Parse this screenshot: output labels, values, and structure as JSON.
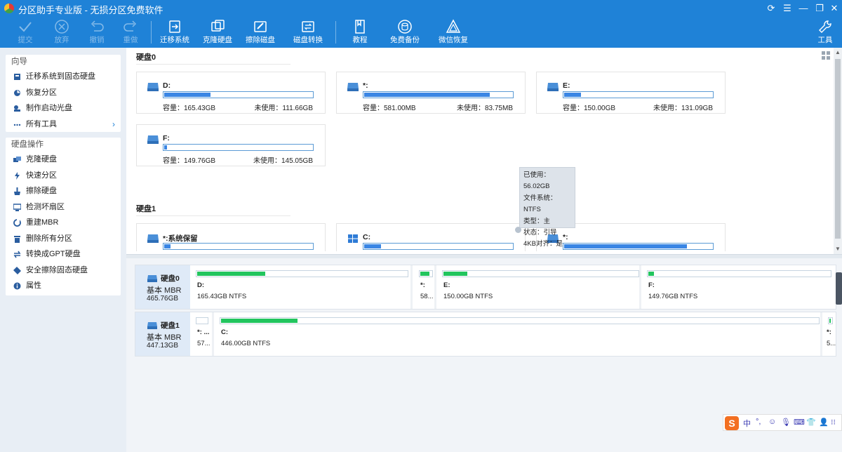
{
  "app": {
    "title": "分区助手专业版 - 无损分区免费软件"
  },
  "colors": {
    "accent": "#1f82d7",
    "used_bar": "#3a86e4",
    "partition_bar": "#22c55e"
  },
  "toolbar": {
    "items": [
      {
        "label": "提交",
        "icon": "check-icon",
        "disabled": true
      },
      {
        "label": "放弃",
        "icon": "discard-icon",
        "disabled": true
      },
      {
        "label": "撤销",
        "icon": "undo-icon",
        "disabled": true
      },
      {
        "label": "重做",
        "icon": "redo-icon",
        "disabled": true
      },
      {
        "label": "迁移系统",
        "icon": "migrate-icon",
        "disabled": false
      },
      {
        "label": "克隆硬盘",
        "icon": "clone-disk-icon",
        "disabled": false
      },
      {
        "label": "擦除磁盘",
        "icon": "wipe-disk-icon",
        "disabled": false
      },
      {
        "label": "磁盘转换",
        "icon": "convert-disk-icon",
        "disabled": false
      },
      {
        "label": "教程",
        "icon": "book-icon",
        "disabled": false
      },
      {
        "label": "免费备份",
        "icon": "backup-icon",
        "disabled": false
      },
      {
        "label": "微信恢复",
        "icon": "recover-icon",
        "disabled": false
      },
      {
        "label": "工具",
        "icon": "wrench-icon",
        "disabled": false
      }
    ]
  },
  "sidebar": {
    "wizard": {
      "title": "向导",
      "items": [
        {
          "label": "迁移系统到固态硬盘",
          "icon": "migrate-ssd-icon"
        },
        {
          "label": "恢复分区",
          "icon": "restore-partition-icon"
        },
        {
          "label": "制作启动光盘",
          "icon": "boot-disc-icon"
        },
        {
          "label": "所有工具",
          "icon": "more-icon"
        }
      ]
    },
    "disk_ops": {
      "title": "硬盘操作",
      "items": [
        {
          "label": "克隆硬盘",
          "icon": "clone-icon"
        },
        {
          "label": "快速分区",
          "icon": "lightning-icon"
        },
        {
          "label": "擦除硬盘",
          "icon": "erase-icon"
        },
        {
          "label": "检测坏扇区",
          "icon": "scan-icon"
        },
        {
          "label": "重建MBR",
          "icon": "rebuild-icon"
        },
        {
          "label": "删除所有分区",
          "icon": "trash-icon"
        },
        {
          "label": "转换成GPT硬盘",
          "icon": "convert-icon"
        },
        {
          "label": "安全擦除固态硬盘",
          "icon": "secure-erase-icon"
        },
        {
          "label": "属性",
          "icon": "info-icon"
        }
      ]
    }
  },
  "disk0": {
    "label": "硬盘0",
    "partitions": [
      {
        "name": "D:",
        "capacity": "容量：165.43GB",
        "free": "未使用：111.66GB",
        "used_fraction": 0.32
      },
      {
        "name": "*:",
        "capacity": "容量：581.00MB",
        "free": "未使用：83.75MB",
        "used_fraction": 0.85
      },
      {
        "name": "E:",
        "capacity": "容量：150.00GB",
        "free": "未使用：131.09GB",
        "used_fraction": 0.12
      },
      {
        "name": "F:",
        "capacity": "容量：149.76GB",
        "free": "未使用：145.05GB",
        "used_fraction": 0.03
      }
    ]
  },
  "disk1": {
    "label": "硬盘1",
    "partitions": [
      {
        "name": "*:系统保留",
        "used_fraction": 0.05
      },
      {
        "name": "C:",
        "used_fraction": 0.12
      },
      {
        "name": "*:",
        "used_fraction": 0.83
      }
    ]
  },
  "tooltip": {
    "used": "已使用：56.02GB",
    "fs": "文件系统：NTFS",
    "type": "类型：主",
    "status": "状态：引导",
    "align": "4KB对齐：是"
  },
  "lower": {
    "disk0": {
      "name": "硬盘0",
      "type": "基本 MBR",
      "size": "465.76GB",
      "parts": [
        {
          "name": "D:",
          "info": "165.43GB NTFS",
          "fill": 0.33
        },
        {
          "name": "*:",
          "info": "58...",
          "fill": 0.85
        },
        {
          "name": "E:",
          "info": "150.00GB NTFS",
          "fill": 0.13
        },
        {
          "name": "F:",
          "info": "149.76GB NTFS",
          "fill": 0.04
        }
      ]
    },
    "disk1": {
      "name": "硬盘1",
      "type": "基本 MBR",
      "size": "447.13GB",
      "parts": [
        {
          "name": "*: ...",
          "info": "57...",
          "fill": 0.05
        },
        {
          "name": "C:",
          "info": "446.00GB NTFS",
          "fill": 0.13
        },
        {
          "name": "*:",
          "info": "5...",
          "fill": 0.8
        }
      ]
    }
  },
  "ime": {
    "logo": "S",
    "lang": "中",
    "punct": "°,"
  }
}
